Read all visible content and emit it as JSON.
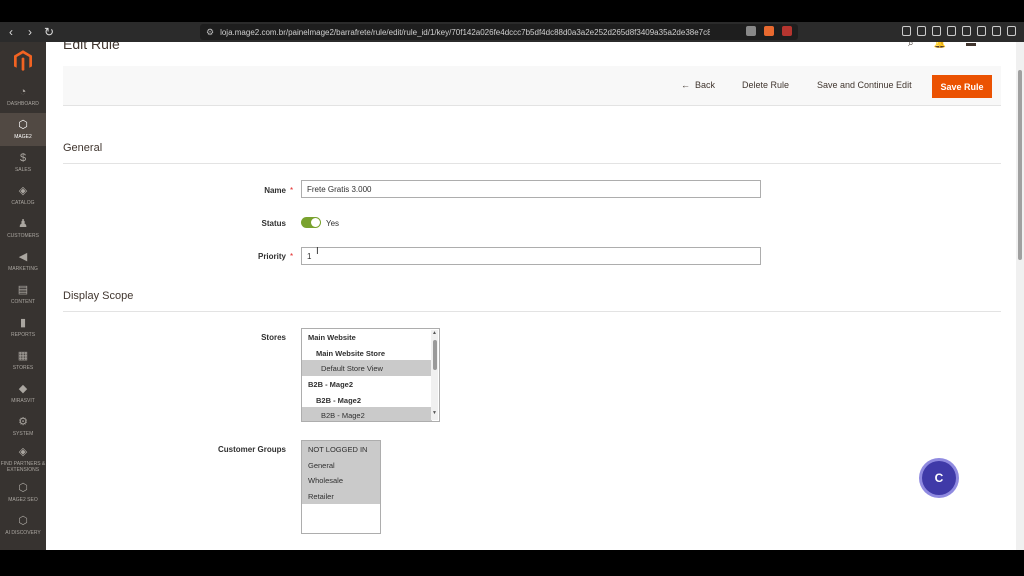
{
  "browser": {
    "url": "loja.mage2.com.br/painelmage2/barrafrete/rule/edit/rule_id/1/key/70f142a026fe4dccc7b5df4dc88d0a3a2e252d265d8f3409a35a2de38e7c87a5/"
  },
  "sidebar": {
    "items": [
      {
        "label": "DASHBOARD",
        "icon": "dashboard-icon"
      },
      {
        "label": "MAGE2",
        "icon": "hexagon-icon"
      },
      {
        "label": "SALES",
        "icon": "dollar-icon"
      },
      {
        "label": "CATALOG",
        "icon": "box-icon"
      },
      {
        "label": "CUSTOMERS",
        "icon": "person-icon"
      },
      {
        "label": "MARKETING",
        "icon": "megaphone-icon"
      },
      {
        "label": "CONTENT",
        "icon": "layout-icon"
      },
      {
        "label": "REPORTS",
        "icon": "bar-chart-icon"
      },
      {
        "label": "STORES",
        "icon": "store-icon"
      },
      {
        "label": "MIRASVIT",
        "icon": "diamond-icon"
      },
      {
        "label": "SYSTEM",
        "icon": "gear-icon"
      },
      {
        "label": "FIND PARTNERS & EXTENSIONS",
        "icon": "cube-icon"
      },
      {
        "label": "MAGE2 SEO",
        "icon": "hexagon-icon"
      },
      {
        "label": "AI DISCOVERY",
        "icon": "hexagon-icon"
      }
    ]
  },
  "page": {
    "title": "Edit Rule"
  },
  "actions": {
    "back": "Back",
    "delete": "Delete Rule",
    "save_continue": "Save and Continue Edit",
    "save": "Save Rule"
  },
  "general": {
    "title": "General",
    "name_label": "Name",
    "name_value": "Frete Gratis 3.000",
    "status_label": "Status",
    "status_value": "Yes",
    "priority_label": "Priority",
    "priority_value": "1"
  },
  "scope": {
    "title": "Display Scope",
    "stores_label": "Stores",
    "stores": [
      {
        "label": "Main Website",
        "bold": true,
        "selected": false
      },
      {
        "label": "Main Website Store",
        "bold": true,
        "selected": false
      },
      {
        "label": "Default Store View",
        "bold": false,
        "selected": true
      },
      {
        "label": "B2B - Mage2",
        "bold": true,
        "selected": false
      },
      {
        "label": "B2B - Mage2",
        "bold": true,
        "selected": false
      },
      {
        "label": "B2B - Mage2",
        "bold": false,
        "selected": true
      }
    ],
    "groups_label": "Customer Groups",
    "groups": [
      {
        "label": "NOT LOGGED IN",
        "selected": true
      },
      {
        "label": "General",
        "selected": true
      },
      {
        "label": "Wholesale",
        "selected": true
      },
      {
        "label": "Retailer",
        "selected": true
      }
    ]
  },
  "chat": {
    "label": "C"
  }
}
